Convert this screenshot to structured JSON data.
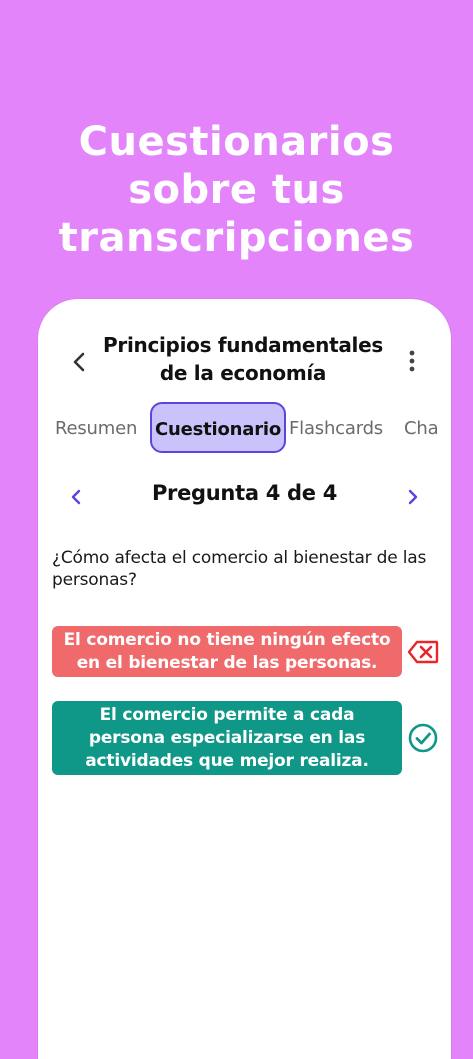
{
  "hero": {
    "line1": "Cuestionarios",
    "line2": "sobre tus",
    "line3": "transcripciones"
  },
  "header": {
    "title_line1": "Principios fundamentales",
    "title_line2": "de la economía"
  },
  "tabs": [
    {
      "label": "Resumen",
      "active": false
    },
    {
      "label": "Cuestionario",
      "active": true
    },
    {
      "label": "Flashcards",
      "active": false
    },
    {
      "label": "Cha",
      "active": false
    }
  ],
  "quiz": {
    "counter": "Pregunta 4 de 4",
    "question": "¿Cómo afecta el comercio al bienestar de las personas?",
    "answers": [
      {
        "text": "El comercio no tiene ningún efecto en el bienestar de las personas.",
        "status": "incorrect"
      },
      {
        "text": "El comercio permite a cada persona especializarse en las actividades que mejor realiza.",
        "status": "correct"
      }
    ]
  },
  "colors": {
    "background": "#e384fb",
    "accent": "#5a45de",
    "tab_active_bg": "#cac2fb",
    "wrong": "#f0696b",
    "wrong_icon": "#e8262b",
    "right": "#0f9787"
  },
  "icons": {
    "back": "chevron-left-icon",
    "more": "more-vertical-icon",
    "prev": "chevron-left-icon",
    "next": "chevron-right-icon",
    "wrong": "backspace-x-icon",
    "right": "check-circle-icon"
  }
}
